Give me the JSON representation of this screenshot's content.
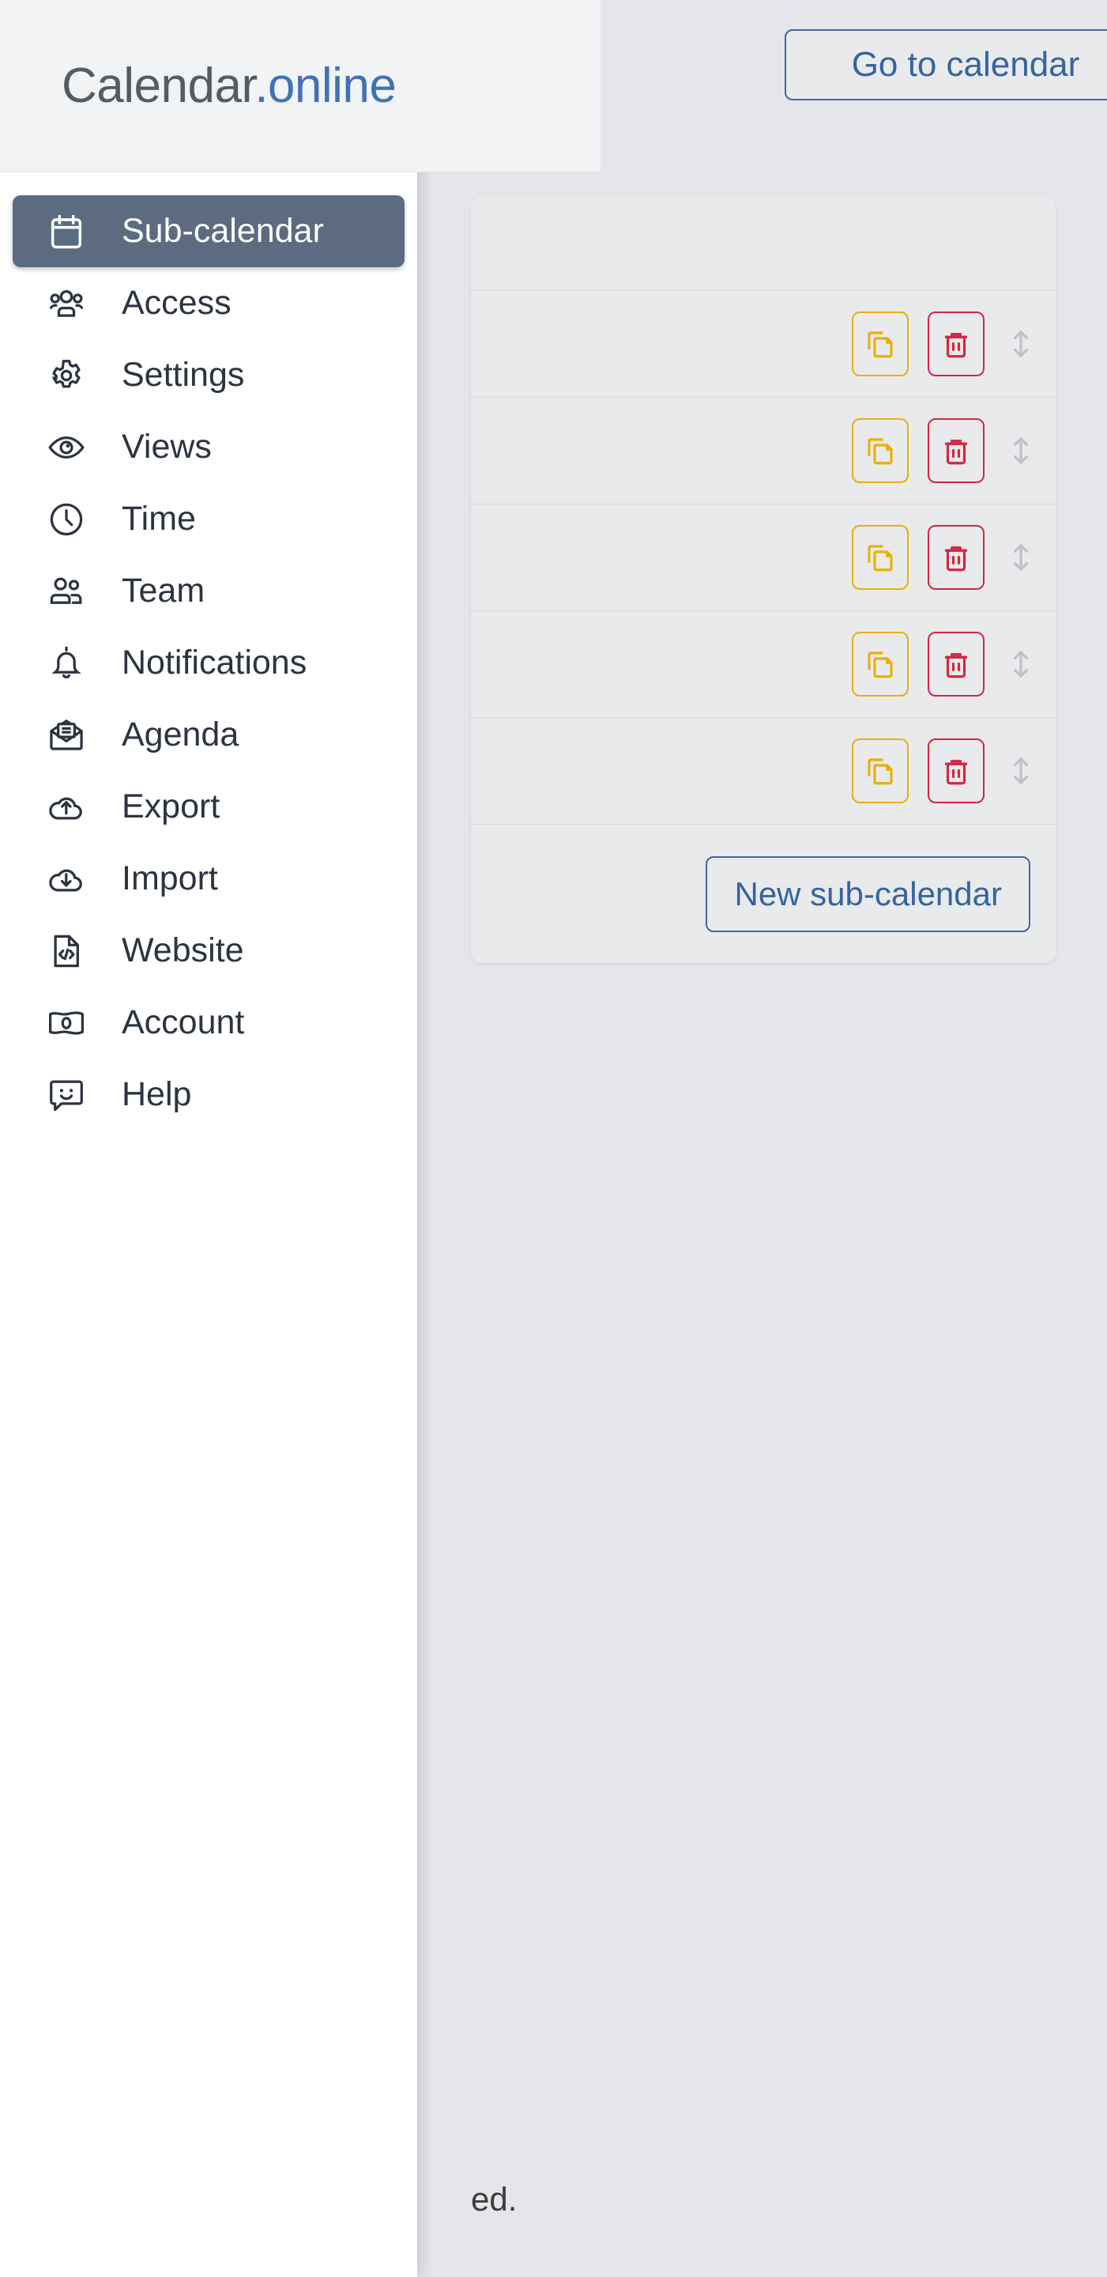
{
  "brand": {
    "part1": "Calendar",
    "part2": ".online"
  },
  "background": {
    "goto_calendar_label": "Go to calendar",
    "new_subcalendar_label": "New sub-calendar",
    "bottom_note": "ed.",
    "row_actions": {
      "copy_label": "copy-icon",
      "delete_label": "trash-icon",
      "reorder_label": "reorder-arrows-icon"
    },
    "rows": [
      {
        "id": 1
      },
      {
        "id": 2
      },
      {
        "id": 3
      },
      {
        "id": 4
      },
      {
        "id": 5
      }
    ],
    "colors": {
      "copy_border": "#e8b007",
      "delete_border": "#d3263f",
      "link_blue": "#3564a0",
      "page_bg": "#e4e6e9",
      "card_bg": "#e9eaec"
    }
  },
  "menu": {
    "active_index": 0,
    "items": [
      {
        "label": "Sub-calendar",
        "icon": "calendar-icon",
        "active": true
      },
      {
        "label": "Access",
        "icon": "users-group-icon",
        "active": false
      },
      {
        "label": "Settings",
        "icon": "gear-icon",
        "active": false
      },
      {
        "label": "Views",
        "icon": "eye-icon",
        "active": false
      },
      {
        "label": "Time",
        "icon": "clock-icon",
        "active": false
      },
      {
        "label": "Team",
        "icon": "two-users-icon",
        "active": false
      },
      {
        "label": "Notifications",
        "icon": "bell-icon",
        "active": false
      },
      {
        "label": "Agenda",
        "icon": "open-envelope-icon",
        "active": false
      },
      {
        "label": "Export",
        "icon": "cloud-upload-icon",
        "active": false
      },
      {
        "label": "Import",
        "icon": "cloud-download-icon",
        "active": false
      },
      {
        "label": "Website",
        "icon": "code-file-icon",
        "active": false
      },
      {
        "label": "Account",
        "icon": "banknote-icon",
        "active": false
      },
      {
        "label": "Help",
        "icon": "smiley-chat-icon",
        "active": false
      }
    ],
    "colors": {
      "active_bg": "#5c6b7f",
      "text": "#2b3440",
      "panel_bg": "#ffffff"
    }
  }
}
